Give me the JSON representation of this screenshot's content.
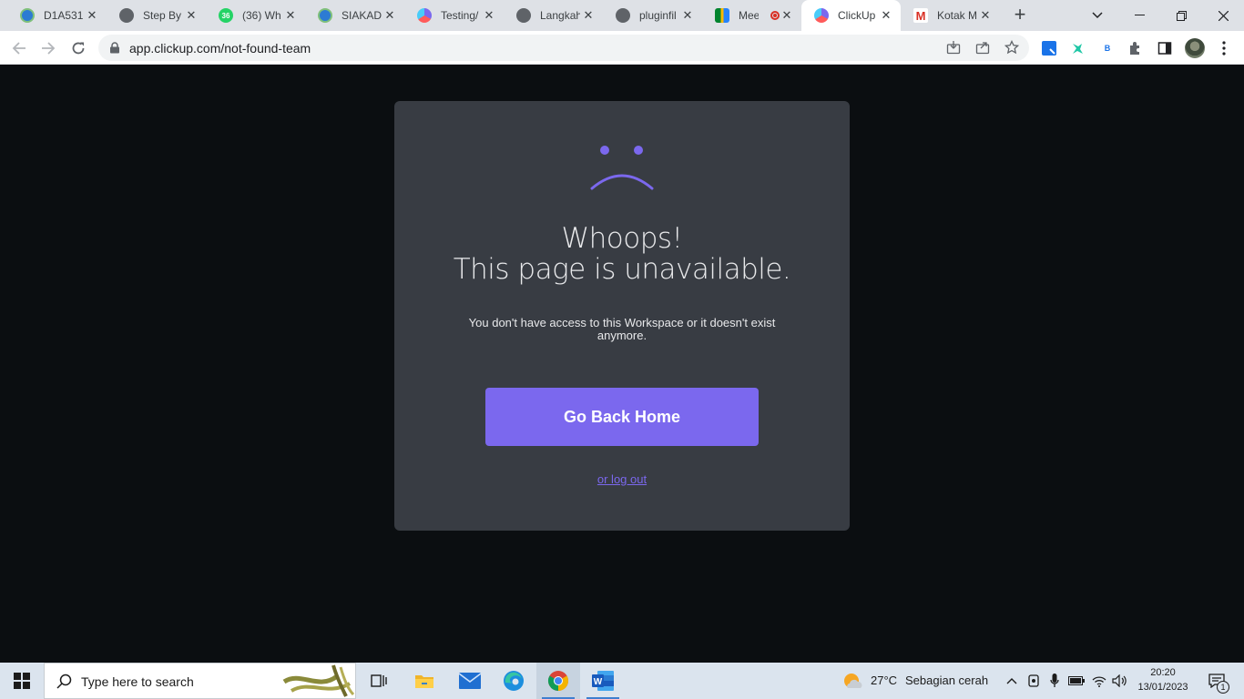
{
  "browser": {
    "tabs": [
      {
        "title": "D1A531",
        "icon": "siakad-globe-icon",
        "color": "#2c7bd3"
      },
      {
        "title": "Step By",
        "icon": "globe-icon",
        "color": "#5f6368"
      },
      {
        "title": "(36) Wh",
        "icon": "whatsapp-icon",
        "color": "#25d366",
        "badge": "36"
      },
      {
        "title": "SIAKAD",
        "icon": "siakad-globe-icon",
        "color": "#2c7bd3"
      },
      {
        "title": "Testing/",
        "icon": "clickup-icon",
        "color": "#7b68ee"
      },
      {
        "title": "Langkah",
        "icon": "globe-icon",
        "color": "#5f6368"
      },
      {
        "title": "pluginfil",
        "icon": "globe-icon",
        "color": "#5f6368"
      },
      {
        "title": "Mee",
        "icon": "google-meet-icon",
        "color": "#00897b"
      },
      {
        "title": "ClickUp",
        "icon": "clickup-icon",
        "color": "#7b68ee"
      },
      {
        "title": "Kotak M",
        "icon": "gmail-icon",
        "color": "#d93025"
      }
    ],
    "url": "app.clickup.com/not-found-team"
  },
  "page": {
    "heading_line1": "Whoops!",
    "heading_line2": "This page is unavailable.",
    "message": "You don't have access to this Workspace or it doesn't exist anymore.",
    "home_button": "Go Back Home",
    "logout_link": "or log out",
    "colors": {
      "accent": "#7b68ee",
      "card": "#383c43",
      "background": "#0b0e11"
    }
  },
  "taskbar": {
    "search_placeholder": "Type here to search",
    "weather_temp": "27°C",
    "weather_desc": "Sebagian cerah",
    "time": "20:20",
    "date": "13/01/2023",
    "notification_count": "1"
  }
}
